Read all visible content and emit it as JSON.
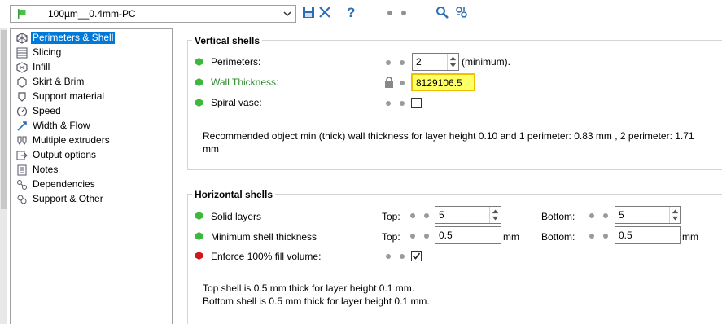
{
  "toolbar": {
    "preset_name": "100µm__0.4mm-PC"
  },
  "tree": {
    "items": [
      {
        "label": "Perimeters & Shell",
        "selected": true,
        "icon": "perimeters-icon"
      },
      {
        "label": "Slicing",
        "icon": "slicing-icon"
      },
      {
        "label": "Infill",
        "icon": "infill-icon"
      },
      {
        "label": "Skirt & Brim",
        "icon": "skirt-icon"
      },
      {
        "label": "Support material",
        "icon": "support-icon"
      },
      {
        "label": "Speed",
        "icon": "speed-icon"
      },
      {
        "label": "Width & Flow",
        "icon": "width-flow-icon"
      },
      {
        "label": "Multiple extruders",
        "icon": "extruders-icon"
      },
      {
        "label": "Output options",
        "icon": "output-icon"
      },
      {
        "label": "Notes",
        "icon": "notes-icon"
      },
      {
        "label": "Dependencies",
        "icon": "dependencies-icon"
      },
      {
        "label": "Support & Other",
        "icon": "support-other-icon"
      }
    ]
  },
  "vertical_shells": {
    "title": "Vertical shells",
    "perimeters": {
      "label": "Perimeters:",
      "value": "2",
      "suffix": "(minimum)."
    },
    "wall_thickness": {
      "label": "Wall Thickness:",
      "value": "8129106.5"
    },
    "spiral_vase": {
      "label": "Spiral vase:"
    },
    "info": "Recommended object min (thick) wall thickness for layer height 0.10 and 1 perimeter: 0.83 mm , 2 perimeter: 1.71",
    "info_wrap": "mm"
  },
  "horizontal_shells": {
    "title": "Horizontal shells",
    "solid_layers": {
      "label": "Solid layers",
      "top_label": "Top:",
      "top_value": "5",
      "bottom_label": "Bottom:",
      "bottom_value": "5"
    },
    "min_shell": {
      "label": "Minimum shell thickness",
      "top_label": "Top:",
      "top_value": "0.5",
      "top_unit": "mm",
      "bottom_label": "Bottom:",
      "bottom_value": "0.5",
      "bottom_unit": "mm"
    },
    "enforce": {
      "label": "Enforce 100% fill volume:"
    },
    "info_line1": "Top shell is 0.5 mm thick for layer height 0.1 mm.",
    "info_line2": "Bottom shell is 0.5 mm thick for layer height 0.1 mm."
  },
  "colors": {
    "accent": "#0078d7",
    "green_status": "#3cb83c",
    "red_status": "#d01818",
    "highlight": "#ffff66"
  }
}
